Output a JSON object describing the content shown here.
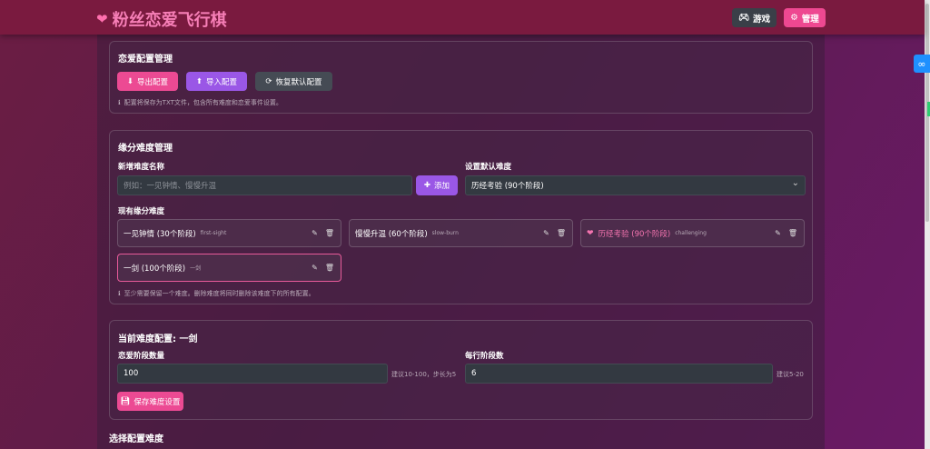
{
  "header": {
    "title": "粉丝恋爱飞行棋",
    "game_label": "游戏",
    "admin_label": "管理"
  },
  "config_card": {
    "title": "恋爱配置管理",
    "export_label": "导出配置",
    "import_label": "导入配置",
    "reset_label": "恢复默认配置",
    "note": "配置将保存为TXT文件，包含所有难度和恋爱事件设置。"
  },
  "difficulty_card": {
    "title": "缘分难度管理",
    "new_name_label": "新增难度名称",
    "new_name_placeholder": "例如：一见钟情、慢慢升温",
    "add_label": "添加",
    "default_label": "设置默认难度",
    "default_value": "历经考验 (90个阶段)",
    "existing_label": "现有缘分难度",
    "items": [
      {
        "name": "一见钟情 (30个阶段)",
        "key": "first-sight"
      },
      {
        "name": "慢慢升温 (60个阶段)",
        "key": "slow-burn"
      },
      {
        "name": "历经考验 (90个阶段)",
        "key": "challenging"
      },
      {
        "name": "一剑 (100个阶段)",
        "key": "一剑"
      }
    ],
    "note": "至少需要保留一个难度。删除难度将同时删除该难度下的所有配置。"
  },
  "current_card": {
    "title": "当前难度配置: 一剑",
    "stages_label": "恋爱阶段数量",
    "stages_value": "100",
    "stages_hint": "建议10-100，步长为5",
    "per_row_label": "每行阶段数",
    "per_row_value": "6",
    "per_row_hint": "建议5-20",
    "save_label": "保存难度设置"
  },
  "select_section": {
    "title": "选择配置难度"
  },
  "colors": {
    "accent_pink": "#ec4a93",
    "accent_purple": "#9a57e6",
    "header_bg": "#7a1a3f"
  }
}
